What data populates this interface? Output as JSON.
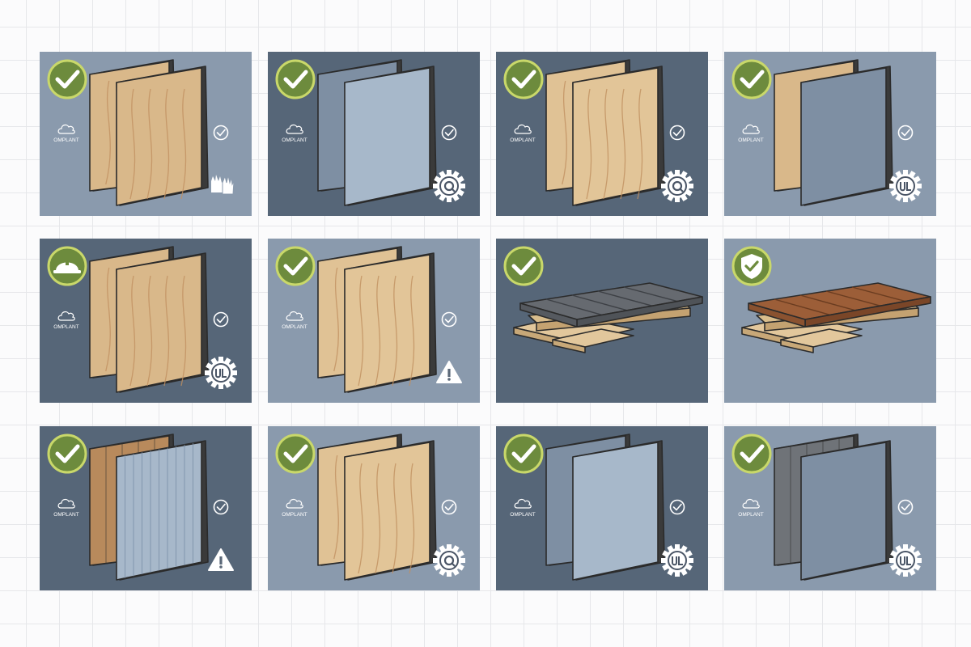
{
  "colors": {
    "tile_light": "#8a9aad",
    "tile_dark": "#566678",
    "badge_green": "#6d8b3d",
    "badge_ring": "#c9d86a",
    "wood": "#d9b88a",
    "wood_grain": "#c09060",
    "gypsum": "#a7b8ca",
    "slate": "#7e8fa3",
    "dark_plank": "#666a70",
    "cedar": "#9c5e38"
  },
  "tiles": [
    {
      "bg": "tile_light",
      "badge": "check-badge",
      "material": "wood-panels",
      "compliance_text": "OMPLANT",
      "corner_icon": "gloves-icon"
    },
    {
      "bg": "tile_dark",
      "badge": "check-badge",
      "material": "gypsum-panels",
      "compliance_text": "OMPLANT",
      "corner_icon": "gear-seal-icon"
    },
    {
      "bg": "tile_dark",
      "badge": "check-badge",
      "material": "wood-panels-light",
      "compliance_text": "OMPLANT",
      "corner_icon": "gear-seal-icon"
    },
    {
      "bg": "tile_light",
      "badge": "check-badge",
      "material": "composite-panels",
      "compliance_text": "OMPLANT",
      "corner_icon": "ul-seal-icon"
    },
    {
      "bg": "tile_dark",
      "badge": "hardhat-badge",
      "material": "wood-panels",
      "compliance_text": "OMPLANT",
      "corner_icon": "ul-seal-icon"
    },
    {
      "bg": "tile_light",
      "badge": "check-badge",
      "material": "wood-panels-light",
      "compliance_text": "OMPLANT",
      "corner_icon": "warning-icon"
    },
    {
      "bg": "tile_dark",
      "badge": "check-badge",
      "material": "dark-planks",
      "compliance_text": "",
      "corner_icon": ""
    },
    {
      "bg": "tile_light",
      "badge": "shield-badge",
      "material": "cedar-planks",
      "compliance_text": "",
      "corner_icon": ""
    },
    {
      "bg": "tile_dark",
      "badge": "check-badge",
      "material": "siding-panels",
      "compliance_text": "OMPLANT",
      "corner_icon": "warning-icon"
    },
    {
      "bg": "tile_light",
      "badge": "check-badge",
      "material": "wood-panels-light",
      "compliance_text": "OMPLANT",
      "corner_icon": "gear-seal-icon"
    },
    {
      "bg": "tile_dark",
      "badge": "check-badge",
      "material": "gypsum-panels",
      "compliance_text": "OMPLANT",
      "corner_icon": "ul-seal-icon"
    },
    {
      "bg": "tile_light",
      "badge": "check-badge",
      "material": "slate-panels",
      "compliance_text": "OMPLANT",
      "corner_icon": "ul-seal-icon"
    }
  ]
}
